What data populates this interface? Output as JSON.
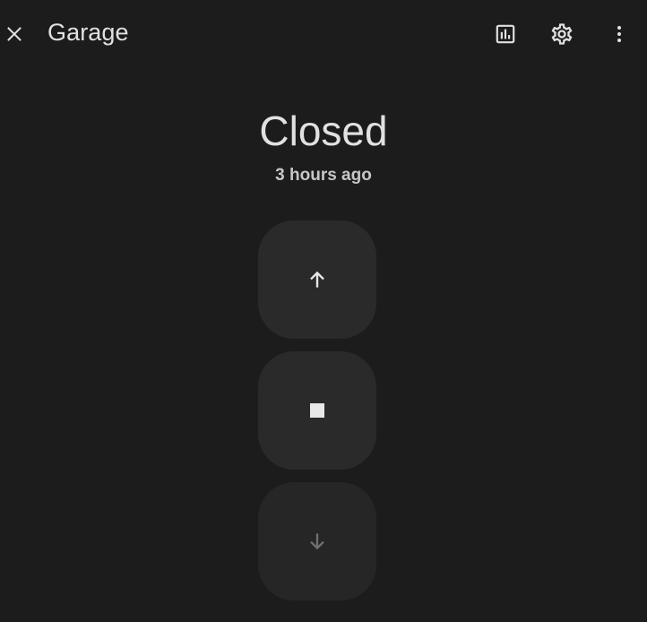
{
  "header": {
    "title": "Garage",
    "close_icon": "close-icon",
    "history_icon": "chart-box-icon",
    "settings_icon": "gear-icon",
    "more_icon": "dots-vertical-icon"
  },
  "entity": {
    "state": "Closed",
    "last_changed": "3 hours ago"
  },
  "controls": [
    {
      "action": "open",
      "icon": "arrow-up-icon",
      "enabled": true
    },
    {
      "action": "stop",
      "icon": "stop-icon",
      "enabled": true
    },
    {
      "action": "close",
      "icon": "arrow-down-icon",
      "enabled": false
    }
  ],
  "colors": {
    "background": "#1c1c1c",
    "control_background": "#2a2a2a",
    "text_primary": "#e1e1e1",
    "icon_disabled": "#6f6f6f"
  }
}
